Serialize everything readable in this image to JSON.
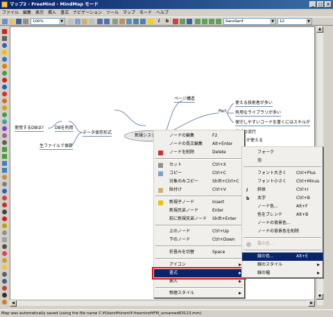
{
  "window": {
    "title": "マップ2 - FreeMind - MindMap モード",
    "min": "_",
    "max": "□",
    "close": "×"
  },
  "menubar": [
    "ファイル",
    "編集",
    "表示",
    "挿入",
    "書式",
    "ナビゲーション",
    "ツール",
    "マップ",
    "モード",
    "ヘルプ"
  ],
  "toolbar": {
    "zoom": "100%",
    "font": "SansSerif",
    "size": "12",
    "italic": "i",
    "bold": "b"
  },
  "map": {
    "root": "新規システムの",
    "left": {
      "db_used": "使用するDBは?",
      "db_use": "DBを利用",
      "data_storage": "データ保存形式",
      "file_storage": "生ファイルで保存"
    },
    "right": {
      "page_structure": "ページ構造",
      "perl": "Perl",
      "many_engineers": "使える技術者が多い",
      "many_libs": "有用なライブラリが多い",
      "easy_code": "保守しやすいコードを書くにはスキルが",
      "trend": "最近の流行",
      "usable": "が使える",
      "more": "..."
    }
  },
  "context_menu": {
    "items": [
      {
        "label": "ノードの編集",
        "shortcut": "F2"
      },
      {
        "label": "ノードの長文編集",
        "shortcut": "Alt+Enter"
      },
      {
        "label": "ノードを削除",
        "shortcut": "Delete"
      },
      {
        "label": "カット",
        "shortcut": "Ctrl+X"
      },
      {
        "label": "コピー",
        "shortcut": "Ctrl+C"
      },
      {
        "label": "対象のみコピー",
        "shortcut": "Shift+Ctrl+C"
      },
      {
        "label": "貼付け",
        "shortcut": "Ctrl+V"
      },
      {
        "label": "新規子ノード",
        "shortcut": "Insert"
      },
      {
        "label": "新規兄弟ノード",
        "shortcut": "Enter"
      },
      {
        "label": "前に新規兄弟ノード",
        "shortcut": "Shift+Enter"
      },
      {
        "label": "上のノード",
        "shortcut": "Ctrl+Up"
      },
      {
        "label": "下のノード",
        "shortcut": "Ctrl+Down"
      },
      {
        "label": "折畳みを切替",
        "shortcut": "Space"
      },
      {
        "label": "アイコン",
        "shortcut": ""
      },
      {
        "label": "書式",
        "shortcut": ""
      },
      {
        "label": "挿入",
        "shortcut": ""
      },
      {
        "label": "物理スタイル",
        "shortcut": ""
      }
    ]
  },
  "format_submenu": {
    "items": [
      {
        "label": "フォーク",
        "shortcut": ""
      },
      {
        "label": "泡",
        "shortcut": ""
      },
      {
        "label": "フォント大きく",
        "shortcut": "Ctrl+Plus"
      },
      {
        "label": "フォント小さく",
        "shortcut": "Ctrl+Minus"
      },
      {
        "label": "斜体",
        "shortcut": "Ctrl+I"
      },
      {
        "label": "太字",
        "shortcut": "Ctrl+B"
      },
      {
        "label": "ノード色...",
        "shortcut": "Alt+F"
      },
      {
        "label": "色をブレンド",
        "shortcut": "Alt+B"
      },
      {
        "label": "ノードの背景色...",
        "shortcut": ""
      },
      {
        "label": "ノードの背景色を削除",
        "shortcut": ""
      },
      {
        "label": "雲の色...",
        "shortcut": ""
      },
      {
        "label": "線の色...",
        "shortcut": "Alt+E"
      },
      {
        "label": "線のスタイル",
        "shortcut": ""
      },
      {
        "label": "線の幅",
        "shortcut": ""
      }
    ]
  },
  "status": "Map was automatically saved (using the file name C:¥Users¥hiromi¥.freemind¥FM_unnamed63113.mm)."
}
